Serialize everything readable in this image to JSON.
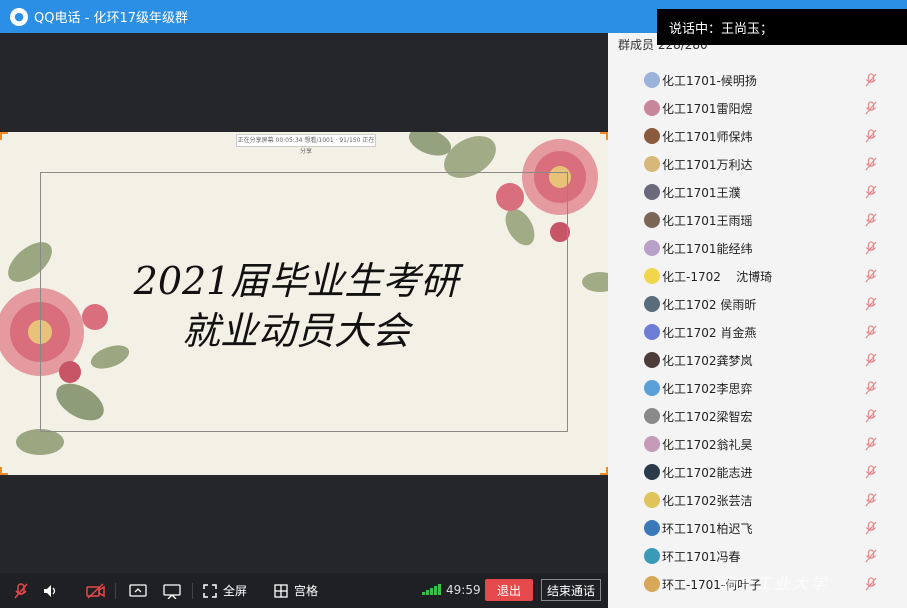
{
  "window": {
    "app": "QQ电话",
    "separator": "-",
    "group": "化环17级年级群"
  },
  "speaking": "说话中：王尚玉；",
  "members": {
    "count_label": "群成员 228/280",
    "list": [
      {
        "name": "化工1701-候明扬",
        "color": "#9bb3d8"
      },
      {
        "name": "化工1701雷阳煜",
        "color": "#c9869b"
      },
      {
        "name": "化工1701师保炜",
        "color": "#8a5a3c"
      },
      {
        "name": "化工1701万利达",
        "color": "#d8b87a"
      },
      {
        "name": "化工1701王濮",
        "color": "#6a6a7a"
      },
      {
        "name": "化工1701王雨瑶",
        "color": "#7a6655"
      },
      {
        "name": "化工1701能经纬",
        "color": "#b9a0c8"
      },
      {
        "name": "化工-1702    沈博琦",
        "color": "#f1d54c"
      },
      {
        "name": "化工1702 侯雨昕",
        "color": "#5a6b7a"
      },
      {
        "name": "化工1702 肖金燕",
        "color": "#6d7dd6"
      },
      {
        "name": "化工1702龚梦岚",
        "color": "#4b3d3a"
      },
      {
        "name": "化工1702李思弈",
        "color": "#5aa0d8"
      },
      {
        "name": "化工1702梁智宏",
        "color": "#8a8a8a"
      },
      {
        "name": "化工1702翁礼昊",
        "color": "#c49ab8"
      },
      {
        "name": "化工1702能志进",
        "color": "#2a3a4a"
      },
      {
        "name": "化工1702张芸洁",
        "color": "#e0c35a"
      },
      {
        "name": "环工1701柏迟飞",
        "color": "#3a7ab8"
      },
      {
        "name": "环工1701冯春",
        "color": "#3a9ab8"
      },
      {
        "name": "环工-1701-何叶子",
        "color": "#d8a85a"
      }
    ]
  },
  "slide": {
    "top_label": "正在分享屏幕    00:05:34        想看/1001 · 91/150 正在分享",
    "line1": "2021届毕业生考研",
    "line2": "就业动员大会"
  },
  "toolbar": {
    "fullscreen": "全屏",
    "grid": "宫格",
    "timer": "49:59",
    "exit": "退出",
    "end_call": "结束通话"
  },
  "watermark": "南京工业大学"
}
